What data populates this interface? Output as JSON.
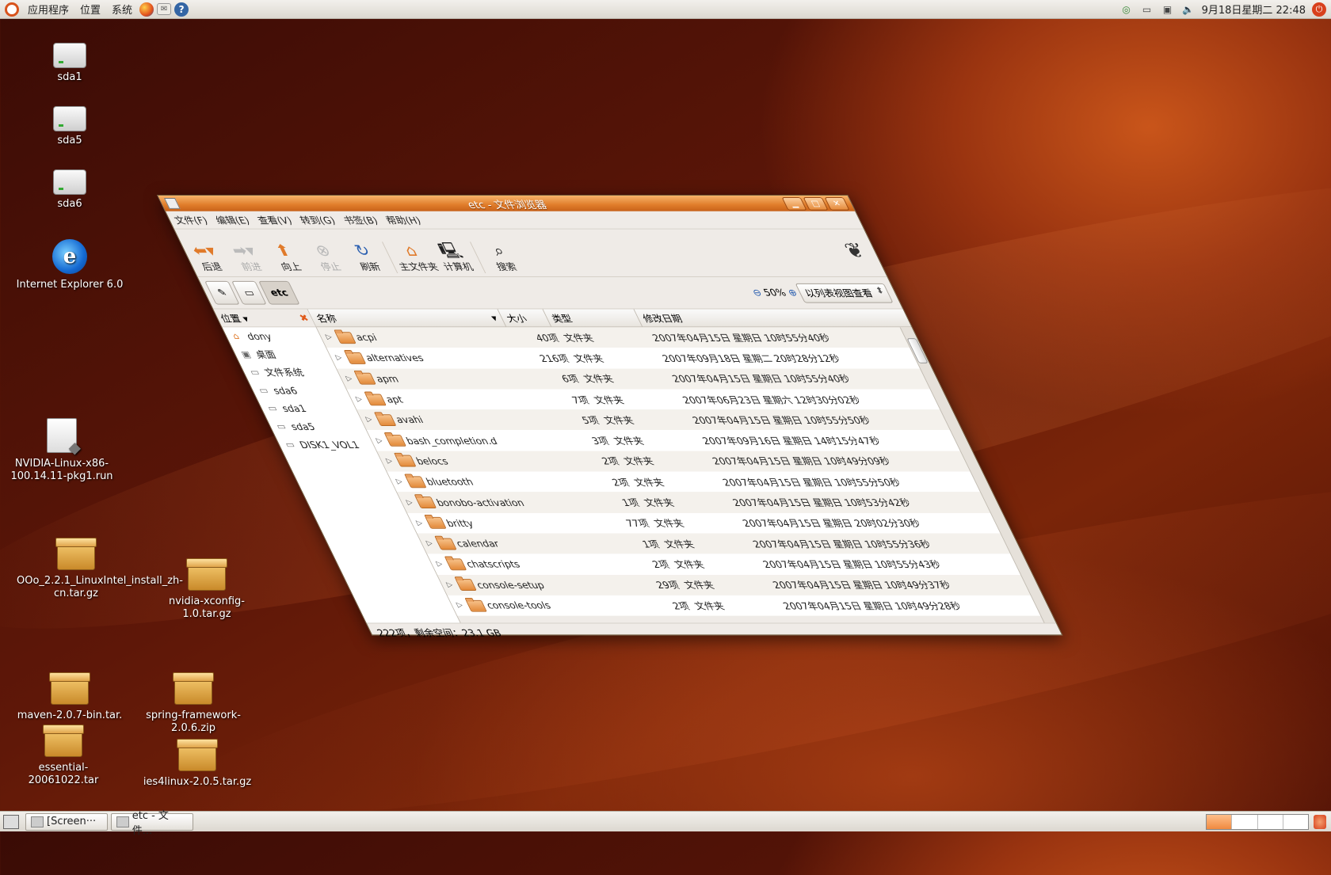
{
  "top_panel": {
    "menus": [
      "应用程序",
      "位置",
      "系统"
    ],
    "clock": "9月18日星期二 22:48"
  },
  "desktop_icons": [
    {
      "label": "sda1",
      "type": "drive"
    },
    {
      "label": "sda5",
      "type": "drive"
    },
    {
      "label": "sda6",
      "type": "drive"
    },
    {
      "label": "Internet Explorer 6.0",
      "type": "ie"
    },
    {
      "label": "NVIDIA-Linux-x86-100.14.11-pkg1.run",
      "type": "file"
    },
    {
      "label": "OOo_2.2.1_LinuxIntel_install_zh-cn.tar.gz",
      "type": "archive"
    },
    {
      "label": "nvidia-xconfig-1.0.tar.gz",
      "type": "archive"
    },
    {
      "label": "maven-2.0.7-bin.tar.",
      "type": "archive"
    },
    {
      "label": "spring-framework-2.0.6.zip",
      "type": "archive"
    },
    {
      "label": "essential-20061022.tar",
      "type": "archive"
    },
    {
      "label": "ies4linux-2.0.5.tar.gz",
      "type": "archive"
    }
  ],
  "window": {
    "title": "etc - 文件浏览器",
    "menus": [
      "文件(F)",
      "编辑(E)",
      "查看(V)",
      "转到(G)",
      "书签(B)",
      "帮助(H)"
    ],
    "toolbar": {
      "back": "后退",
      "forward": "前进",
      "up": "向上",
      "stop": "停止",
      "reload": "刷新",
      "home": "主文件夹",
      "computer": "计算机",
      "search": "搜索"
    },
    "location": {
      "current": "etc",
      "zoom": "50%",
      "view_mode": "以列表视图查看"
    },
    "sidebar": {
      "title": "位置",
      "items": [
        "dony",
        "桌面",
        "文件系统",
        "sda6",
        "sda1",
        "sda5",
        "DISK1_VOL1"
      ]
    },
    "columns": {
      "name": "名称",
      "size": "大小",
      "type": "类型",
      "date": "修改日期"
    },
    "files": [
      {
        "name": "acpi",
        "size": "40项",
        "type": "文件夹",
        "date": "2007年04月15日 星期日 10时55分40秒"
      },
      {
        "name": "alternatives",
        "size": "216项",
        "type": "文件夹",
        "date": "2007年09月18日 星期二 20时28分12秒"
      },
      {
        "name": "apm",
        "size": "6项",
        "type": "文件夹",
        "date": "2007年04月15日 星期日 10时55分40秒"
      },
      {
        "name": "apt",
        "size": "7项",
        "type": "文件夹",
        "date": "2007年06月23日 星期六 12时30分02秒"
      },
      {
        "name": "avahi",
        "size": "5项",
        "type": "文件夹",
        "date": "2007年04月15日 星期日 10时55分50秒"
      },
      {
        "name": "bash_completion.d",
        "size": "3项",
        "type": "文件夹",
        "date": "2007年09月16日 星期日 14时15分47秒"
      },
      {
        "name": "belocs",
        "size": "2项",
        "type": "文件夹",
        "date": "2007年04月15日 星期日 10时49分09秒"
      },
      {
        "name": "bluetooth",
        "size": "2项",
        "type": "文件夹",
        "date": "2007年04月15日 星期日 10时55分50秒"
      },
      {
        "name": "bonobo-activation",
        "size": "1项",
        "type": "文件夹",
        "date": "2007年04月15日 星期日 10时53分42秒"
      },
      {
        "name": "britty",
        "size": "77项",
        "type": "文件夹",
        "date": "2007年04月15日 星期日 20时02分30秒"
      },
      {
        "name": "calendar",
        "size": "1项",
        "type": "文件夹",
        "date": "2007年04月15日 星期日 10时55分36秒"
      },
      {
        "name": "chatscripts",
        "size": "2项",
        "type": "文件夹",
        "date": "2007年04月15日 星期日 10时55分43秒"
      },
      {
        "name": "console-setup",
        "size": "29项",
        "type": "文件夹",
        "date": "2007年04月15日 星期日 10时49分37秒"
      },
      {
        "name": "console-tools",
        "size": "2项",
        "type": "文件夹",
        "date": "2007年04月15日 星期日 10时49分28秒"
      }
    ],
    "status": "222项，剩余空间：23.1 GB"
  },
  "taskbar": {
    "tasks": [
      "[Screen···",
      "etc - 文件..."
    ]
  }
}
